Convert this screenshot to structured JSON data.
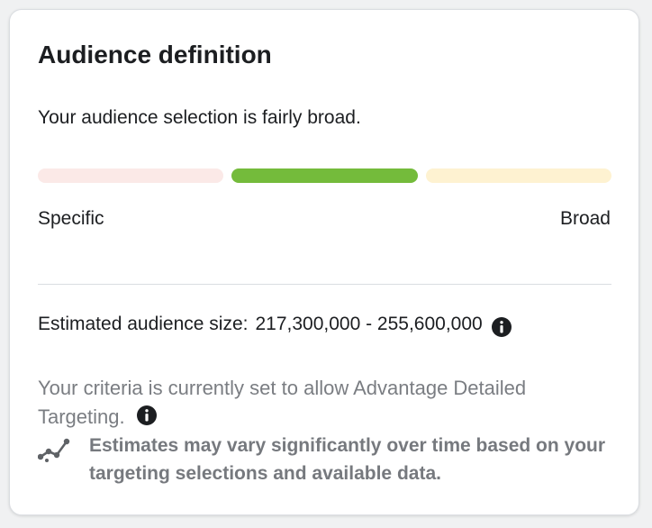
{
  "card": {
    "title": "Audience definition",
    "summary": "Your audience selection is fairly broad.",
    "meter": {
      "segments": [
        "specific",
        "middle",
        "broad"
      ],
      "active_segment": "middle",
      "colors": {
        "specific": "#fbe9e7",
        "middle": "#74bb3b",
        "broad": "#fef2d1"
      },
      "label_left": "Specific",
      "label_right": "Broad"
    },
    "estimated_size": {
      "label": "Estimated audience size:",
      "value": "217,300,000 - 255,600,000",
      "info_icon": "info-icon"
    },
    "criteria": {
      "text": "Your criteria is currently set to allow Advantage Detailed Targeting.",
      "info_icon": "info-icon"
    },
    "estimate_note": {
      "icon": "trend-line-icon",
      "text": "Estimates may vary significantly over time based on your targeting selections and available data."
    }
  }
}
